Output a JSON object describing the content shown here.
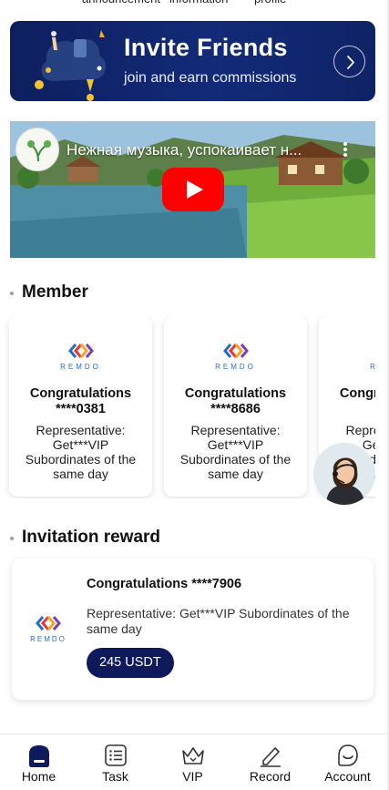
{
  "top_nav": {
    "labels": [
      "announcement",
      "information",
      "profile"
    ]
  },
  "banner": {
    "title": "Invite Friends",
    "subtitle": "join and earn commissions",
    "arrow_icon": "chevron-right-icon"
  },
  "video": {
    "title": "Нежная музыка, успокаивает н...",
    "play_icon": "youtube-play-icon",
    "menu_icon": "more-vertical-icon"
  },
  "member_section": {
    "title": "Member",
    "cards": [
      {
        "brand": "REMDO",
        "title_line1": "Congratulations",
        "title_line2": "****0381",
        "desc": "Representative: Get***VIP Subordinates of the same day"
      },
      {
        "brand": "REMDO",
        "title_line1": "Congratulations",
        "title_line2": "****8686",
        "desc": "Representative: Get***VIP Subordinates of the same day"
      },
      {
        "brand": "REMDO",
        "title_line1": "Congratulations",
        "title_line2": "****",
        "desc": "Representative: Get***VIP Subordinates of the same day"
      }
    ]
  },
  "reward_section": {
    "title": "Invitation reward",
    "card": {
      "brand": "REMDO",
      "title": "Congratulations ****7906",
      "desc": "Representative: Get***VIP Subordinates of the same day",
      "amount": "245 USDT"
    }
  },
  "tabbar": {
    "tabs": [
      {
        "label": "Home",
        "icon": "home-icon",
        "active": true
      },
      {
        "label": "Task",
        "icon": "task-list-icon",
        "active": false
      },
      {
        "label": "VIP",
        "icon": "crown-icon",
        "active": false
      },
      {
        "label": "Record",
        "icon": "pencil-icon",
        "active": false
      },
      {
        "label": "Account",
        "icon": "account-icon",
        "active": false
      }
    ]
  },
  "colors": {
    "banner_bg": "#0d1f5e",
    "reward_button": "#0e1a5c",
    "youtube_red": "#ff0000",
    "brand_blue": "#1f6fd1"
  }
}
